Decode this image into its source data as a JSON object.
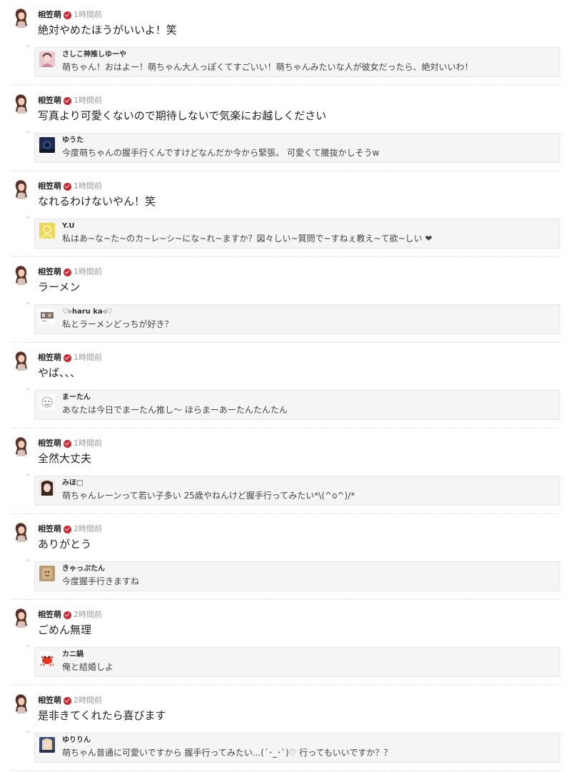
{
  "verified_color": "#d0242c",
  "posts": [
    {
      "author": "相笠萌",
      "time": "1時間前",
      "text": "絶対やめたほうがいいよ！笑",
      "reply": {
        "name": "さしこ神推しゆーや",
        "text": "萌ちゃん！おはよー！萌ちゃん大人っぽくてすごいい！萌ちゃんみたいな人が彼女だったら、絶対いいわ！",
        "avatar": "photo-pink"
      }
    },
    {
      "author": "相笠萌",
      "time": "1時間前",
      "text": "写真より可愛くないので期待しないで気楽にお越しください",
      "reply": {
        "name": "ゆうた",
        "text": "今度萌ちゃんの握手行くんですけどなんだか今から緊張。 可愛くて腰抜かしそうw",
        "avatar": "photo-dark-blue"
      }
    },
    {
      "author": "相笠萌",
      "time": "1時間前",
      "text": "なれるわけないやん！笑",
      "reply": {
        "name": "Y.U",
        "text": "私はあ~な~た~のカ~レ~シ~にな~れ~ますか？図々しい~質問で~すねぇ教え~て欲~しい ❤",
        "avatar": "default-yellow"
      }
    },
    {
      "author": "相笠萌",
      "time": "1時間前",
      "text": "ラーメン",
      "reply": {
        "name": "♡▹haru ka◃♡",
        "text": "私とラーメンどっちが好き？",
        "avatar": "photo-small"
      }
    },
    {
      "author": "相笠萌",
      "time": "1時間前",
      "text": "やば、、、",
      "reply": {
        "name": "まーたん",
        "text": "あなたは今日でまーたん推し〜 ほらまーあーたんたんたん",
        "avatar": "sketch"
      }
    },
    {
      "author": "相笠萌",
      "time": "1時間前",
      "text": "全然大丈夫",
      "reply": {
        "name": "みほ□",
        "text": "萌ちゃんレーンって若い子多い 25歳やねんけど握手行ってみたい*\\(^o^)/*",
        "avatar": "photo-face"
      }
    },
    {
      "author": "相笠萌",
      "time": "2時間前",
      "text": "ありがとう",
      "reply": {
        "name": "きゃっぷたん",
        "text": "今度握手行きますね",
        "avatar": "photo-tan"
      }
    },
    {
      "author": "相笠萌",
      "time": "2時間前",
      "text": "ごめん無理",
      "reply": {
        "name": "カニ鍋",
        "text": "俺と結婚しよ",
        "avatar": "crab"
      }
    },
    {
      "author": "相笠萌",
      "time": "2時間前",
      "text": "是非きてくれたら喜びます",
      "reply": {
        "name": "ゆりりん",
        "text": "萌ちゃん普通に可愛いですから 握手行ってみたい...(´･_･`)♡ 行ってもいいですか？？",
        "avatar": "photo-girl"
      }
    }
  ]
}
